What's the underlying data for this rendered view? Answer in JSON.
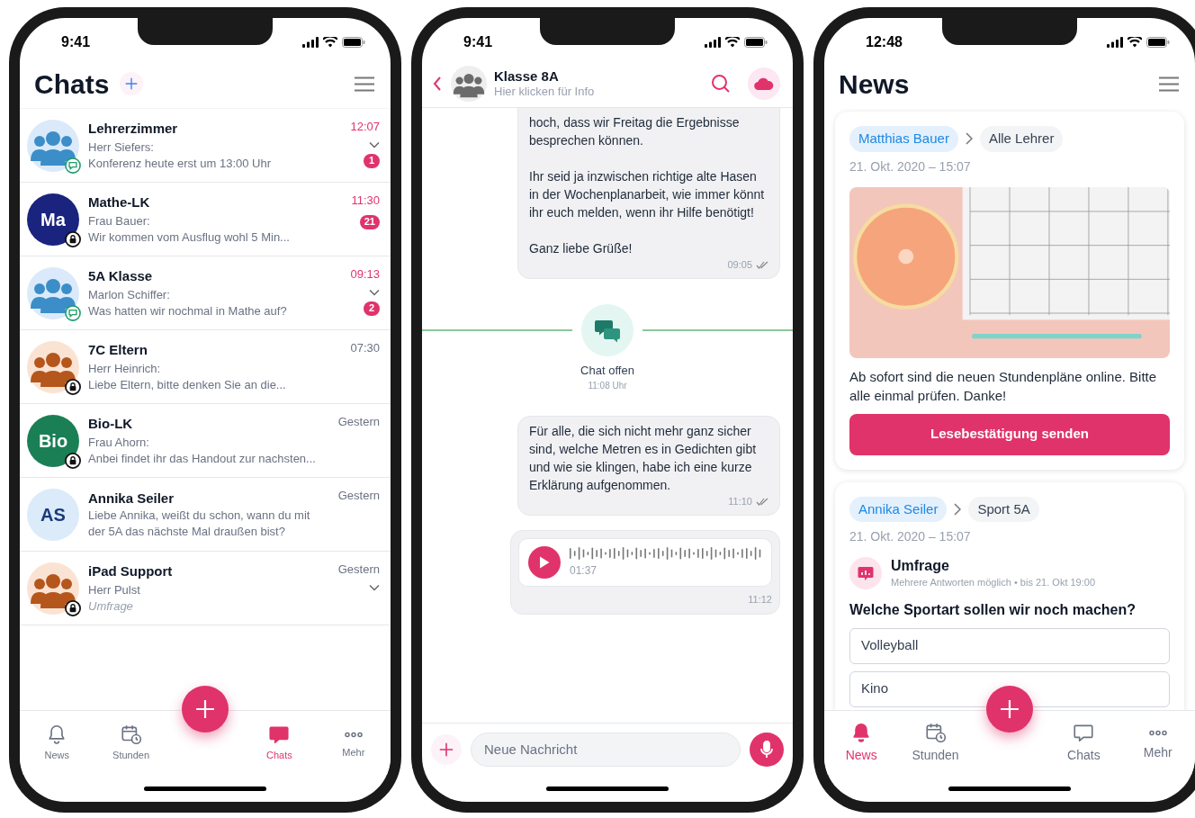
{
  "phones": [
    {
      "kind": "chats",
      "status_time": "9:41",
      "title": "Chats",
      "chats": [
        {
          "name": "Lehrerzimmer",
          "sender": "Herr Siefers:",
          "preview": "Konferenz heute erst um 13:00 Uhr",
          "time": "12:07",
          "unread": true,
          "expandable": true,
          "badge": "1",
          "poll": false,
          "avatar": {
            "kind": "group",
            "overlay": {
              "kind": "chat"
            }
          }
        },
        {
          "name": "Mathe-LK",
          "sender": "Frau Bauer:",
          "preview": "Wir kommen vom Ausflug wohl 5 Min...",
          "time": "11:30",
          "unread": true,
          "expandable": false,
          "badge": "21",
          "poll": false,
          "avatar": {
            "kind": "initials",
            "initials": "Ma",
            "color": "#1a237e",
            "overlay": {
              "kind": "lock"
            }
          }
        },
        {
          "name": "5A Klasse",
          "sender": "Marlon Schiffer:",
          "preview": "Was hatten wir nochmal in Mathe auf?",
          "time": "09:13",
          "unread": true,
          "expandable": true,
          "badge": "2",
          "poll": false,
          "avatar": {
            "kind": "group",
            "overlay": {
              "kind": "chat"
            }
          }
        },
        {
          "name": "7C Eltern",
          "sender": "Herr Heinrich:",
          "preview": "Liebe Eltern, bitte denken Sie an die...",
          "time": "07:30",
          "unread": false,
          "expandable": false,
          "poll": false,
          "avatar": {
            "kind": "family",
            "overlay": {
              "kind": "lock"
            }
          }
        },
        {
          "name": "Bio-LK",
          "sender": "Frau Ahorn:",
          "preview": "Anbei findet ihr das Handout zur nachsten...",
          "time": "Gestern",
          "unread": false,
          "expandable": false,
          "poll": false,
          "avatar": {
            "kind": "initials",
            "initials": "Bio",
            "color": "#1b7f56",
            "overlay": {
              "kind": "lock"
            }
          }
        },
        {
          "name": "Annika Seiler",
          "preview": "Liebe Annika, weißt du schon, wann du mit der 5A das nächste Mal draußen bist?",
          "time": "Gestern",
          "unread": false,
          "expandable": false,
          "poll": false,
          "avatar": {
            "kind": "initials",
            "initials": "AS",
            "color": "#dcebfa"
          }
        },
        {
          "name": "iPad Support",
          "sender": "Herr Pulst",
          "preview": "Umfrage",
          "time": "Gestern",
          "unread": false,
          "expandable": true,
          "poll": true,
          "avatar": {
            "kind": "family",
            "overlay": {
              "kind": "lock"
            }
          }
        }
      ],
      "tabs": [
        {
          "label": "News",
          "kind": "bell",
          "selected": false
        },
        {
          "label": "Stunden",
          "kind": "calendar",
          "selected": false
        },
        {
          "label": "Chats",
          "kind": "chat",
          "selected": true
        },
        {
          "label": "Mehr",
          "kind": "more",
          "selected": false
        }
      ]
    },
    {
      "kind": "conversation",
      "status_time": "9:41",
      "title": "Klasse 8A",
      "subtitle": "Hier klicken für Info",
      "messages": [
        {
          "kind": "text",
          "paragraphs": [
            "hoch, dass wir Freitag die Ergebnisse besprechen können.",
            "Ihr seid ja inzwischen richtige alte Hasen in der Wochenplanarbeit, wie immer könnt ihr euch melden, wenn ihr Hilfe benötigt!",
            "Ganz liebe Grüße!"
          ],
          "time": "09:05",
          "read": true
        },
        {
          "kind": "event",
          "label": "Chat offen",
          "time": "11:08 Uhr"
        },
        {
          "kind": "text",
          "paragraphs": [
            "Für alle, die sich nicht mehr ganz sicher sind, welche Metren es in Gedichten gibt und wie sie klingen, habe ich eine kurze Erklärung aufgenommen."
          ],
          "time": "11:10",
          "read": true
        },
        {
          "kind": "audio",
          "duration": "01:37",
          "time": "11:12",
          "read": false
        }
      ],
      "placeholder": "Neue Nachricht"
    },
    {
      "kind": "news",
      "status_time": "12:48",
      "title": "News",
      "posts": [
        {
          "kind": "image",
          "author": "Matthias Bauer",
          "audience": "Alle Lehrer",
          "date": "21. Okt. 2020 – 15:07",
          "text": "Ab sofort sind die neuen Stundenpläne online. Bitte alle einmal prüfen. Danke!",
          "button": "Lesebestätigung senden"
        },
        {
          "kind": "poll",
          "author": "Annika Seiler",
          "audience": "Sport 5A",
          "date": "21. Okt. 2020 – 15:07",
          "poll_title": "Umfrage",
          "poll_info": "Mehrere Antworten möglich • bis 21. Okt 19:00",
          "question": "Welche Sportart sollen wir noch machen?",
          "options": [
            "Volleyball",
            "Kino"
          ]
        }
      ],
      "tabs": [
        {
          "label": "News",
          "kind": "bell",
          "selected": true
        },
        {
          "label": "Stunden",
          "kind": "calendar",
          "selected": false
        },
        {
          "label": "Chats",
          "kind": "chat",
          "selected": false
        },
        {
          "label": "Mehr",
          "kind": "more",
          "selected": false
        }
      ]
    }
  ]
}
